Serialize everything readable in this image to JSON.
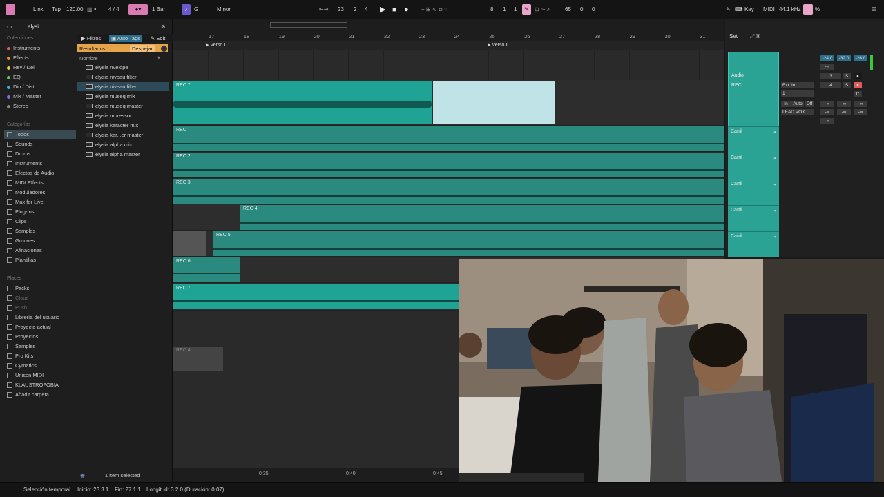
{
  "transport": {
    "link": "Link",
    "tap": "Tap",
    "tempo": "120.00",
    "meter": "4 / 4",
    "quant": "1 Bar",
    "key": "G",
    "scale": "Minor",
    "pos_bar": "23",
    "pos_beat": "2",
    "pos_sixteenth": "4",
    "loop_bar": "8",
    "loop_beat": "1",
    "loop_sixteenth": "1",
    "cpu_a": "65",
    "cpu_b": "0",
    "cpu_c": "0",
    "key_label": "Key",
    "midi_label": "MIDI",
    "samplerate": "44.1 kHz",
    "percent": "%"
  },
  "browser": {
    "search_value": "elysi",
    "collections_heading": "Colecciones",
    "collections": [
      {
        "label": "Instruments",
        "color": "#e35a5a"
      },
      {
        "label": "Effects",
        "color": "#f08a2a"
      },
      {
        "label": "Rev / Del",
        "color": "#e8c84a"
      },
      {
        "label": "EQ",
        "color": "#5ac85a"
      },
      {
        "label": "Din / Dist",
        "color": "#3ab0e0"
      },
      {
        "label": "Mix / Master",
        "color": "#8a6ae0"
      },
      {
        "label": "Stereo",
        "color": "#888888"
      }
    ],
    "categories_heading": "Categorías",
    "categories": [
      "Todos",
      "Sounds",
      "Drums",
      "Instruments",
      "Efectos de Audio",
      "MIDI Effects",
      "Moduladores",
      "Max for Live",
      "Plug-Ins",
      "Clips",
      "Samples",
      "Grooves",
      "Afinaciones",
      "Plantillas"
    ],
    "places_heading": "Places",
    "places": [
      "Packs",
      "Cloud",
      "Push",
      "Librería del usuario",
      "Proyecto actual",
      "Proyectos",
      "Samples",
      "Pro Kits",
      "Cymatics",
      "Unison MIDI",
      "KLAUSTROFOBIA",
      "Añadir carpeta..."
    ],
    "filters_label": "Filtros",
    "autotags_label": "Auto Tags",
    "edit_label": "Edit",
    "results_label": "Resultados",
    "clear_label": "Despejar",
    "name_header": "Nombre",
    "results": [
      "elysia nvelope",
      "elysia niveau filter",
      "elysia niveau filter",
      "elysia museq mix",
      "elysia museq master",
      "elysia mpressor",
      "elysia karacter mix",
      "elysia kar...er master",
      "elysia alpha mix",
      "elysia alpha master"
    ],
    "selection_count": "1 item selected"
  },
  "arrangement": {
    "bars": [
      "17",
      "18",
      "19",
      "20",
      "21",
      "22",
      "23",
      "24",
      "25",
      "26",
      "27",
      "28",
      "29",
      "30",
      "31"
    ],
    "locators": [
      "Verso I",
      "Verso II"
    ],
    "tracks": [
      "REC 7",
      "REC",
      "REC 2",
      "REC 3",
      "REC 4",
      "REC 5",
      "REC 6",
      "REC 7",
      "REC 4"
    ],
    "time_marks": [
      "0:35",
      "0:40",
      "0:45"
    ]
  },
  "mixer": {
    "set_label": "Set",
    "audio_label": "Audio",
    "rec_label": "REC",
    "ext_in": "Ext. In",
    "input_ch": "1",
    "monitor_in": "In",
    "monitor_auto": "Auto",
    "monitor_off": "Off",
    "output": "LEAD VOX",
    "vol_a": "-24.0",
    "vol_b": "-32.0",
    "vol_c": "-26.0",
    "neg_inf": "-∞",
    "track_num": "3",
    "track_num2": "4",
    "solo": "S",
    "center": "C",
    "lane_labels": [
      "Carril",
      "Carril",
      "Carril",
      "Carril",
      "Carril"
    ]
  },
  "status": {
    "mode": "Selección temporal",
    "start": "Inicio: 23.3.1",
    "end": "Fin: 27.1.1",
    "length": "Longitud: 3.2.0 (Duración: 0:07)"
  },
  "colors": {
    "clip": "#1fa394",
    "accent": "#e8a5c8",
    "selection": "#bfe3e6"
  }
}
